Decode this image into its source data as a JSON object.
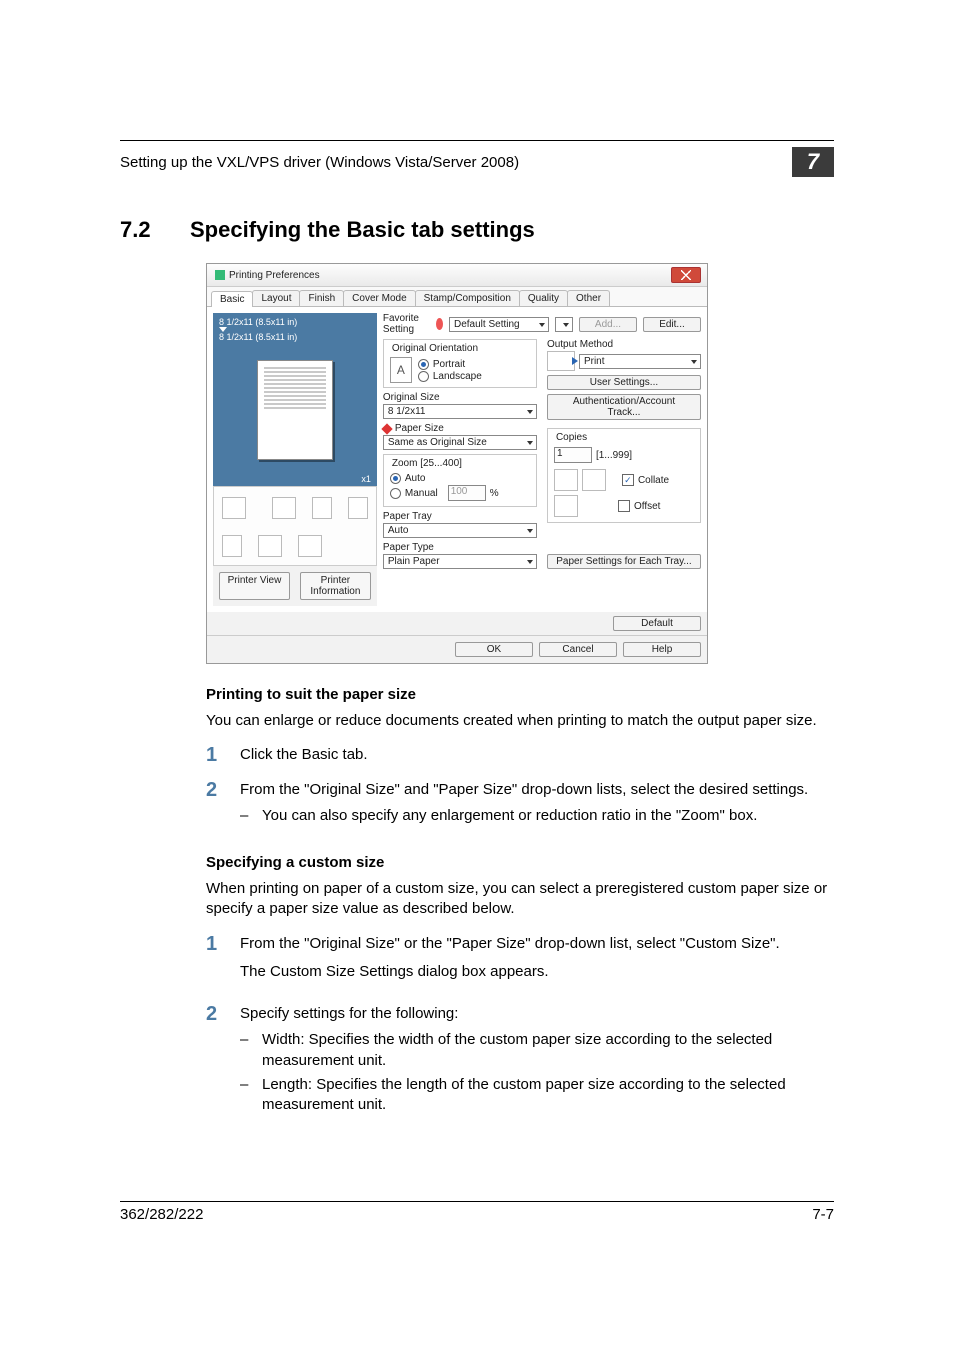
{
  "header": {
    "title": "Setting up the VXL/VPS driver (Windows Vista/Server 2008)",
    "chapter": "7"
  },
  "h2": {
    "num": "7.2",
    "title": "Specifying the Basic tab settings"
  },
  "dialog": {
    "title": "Printing Preferences",
    "tabs": [
      "Basic",
      "Layout",
      "Finish",
      "Cover Mode",
      "Stamp/Composition",
      "Quality",
      "Other"
    ],
    "preview": {
      "line1": "8 1/2x11 (8.5x11 in)",
      "line2": "8 1/2x11 (8.5x11 in)",
      "x1": "x1",
      "printer_view": "Printer View",
      "printer_info": "Printer Information"
    },
    "favorite_label": "Favorite Setting",
    "favorite_value": "Default Setting",
    "add_btn": "Add...",
    "edit_btn": "Edit...",
    "orient": {
      "legend": "Original Orientation",
      "portrait": "Portrait",
      "landscape": "Landscape"
    },
    "original_size": {
      "label": "Original Size",
      "value": "8 1/2x11"
    },
    "paper_size": {
      "label": "Paper Size",
      "value": "Same as Original Size"
    },
    "zoom": {
      "legend": "Zoom [25...400]",
      "auto": "Auto",
      "manual": "Manual",
      "value": "100",
      "pct": "%"
    },
    "tray": {
      "label": "Paper Tray",
      "value": "Auto"
    },
    "type": {
      "label": "Paper Type",
      "value": "Plain Paper"
    },
    "output": {
      "label": "Output Method",
      "value": "Print"
    },
    "user_settings": "User Settings...",
    "auth": "Authentication/Account Track...",
    "copies": {
      "legend": "Copies",
      "value": "1",
      "range": "[1...999]",
      "collate": "Collate",
      "offset": "Offset"
    },
    "paper_each": "Paper Settings for Each Tray...",
    "default_btn": "Default",
    "ok": "OK",
    "cancel": "Cancel",
    "help": "Help"
  },
  "sect1": {
    "heading": "Printing to suit the paper size",
    "intro": "You can enlarge or reduce documents created when printing to match the output paper size.",
    "steps": [
      {
        "n": "1",
        "t": "Click the Basic tab."
      },
      {
        "n": "2",
        "t": "From the \"Original Size\" and \"Paper Size\" drop-down lists, select the desired settings.",
        "sub": [
          "You can also specify any enlargement or reduction ratio in the \"Zoom\" box."
        ]
      }
    ]
  },
  "sect2": {
    "heading": "Specifying a custom size",
    "intro": "When printing on paper of a custom size, you can select a preregistered custom paper size or specify a paper size value as described below.",
    "steps": [
      {
        "n": "1",
        "t": "From the \"Original Size\" or the \"Paper Size\" drop-down list, select \"Custom Size\".",
        "after": "The Custom Size Settings dialog box appears."
      },
      {
        "n": "2",
        "t": "Specify settings for the following:",
        "sub": [
          "Width: Specifies the width of the custom paper size according to the selected measurement unit.",
          "Length: Specifies the length of the custom paper size according to the selected measurement unit."
        ]
      }
    ]
  },
  "footer": {
    "left": "362/282/222",
    "right": "7-7"
  }
}
